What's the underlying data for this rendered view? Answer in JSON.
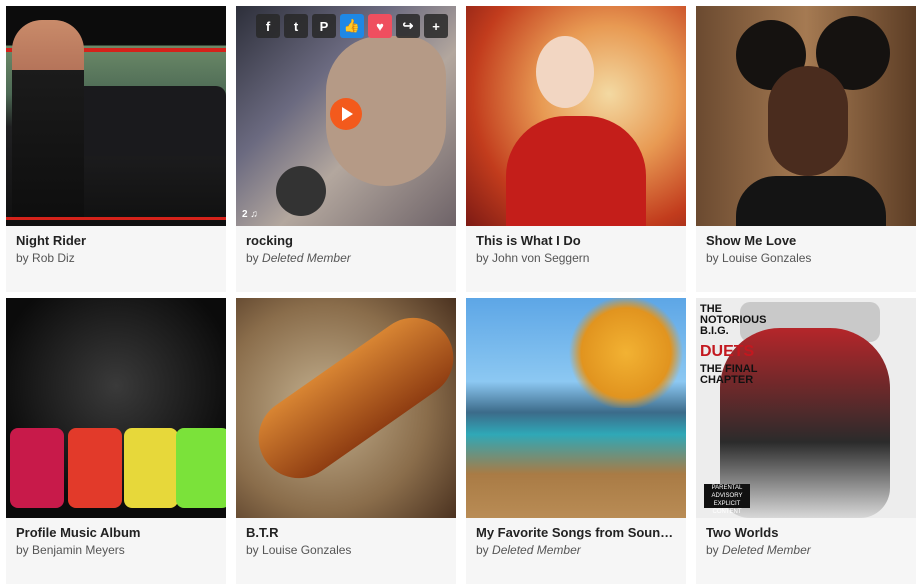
{
  "albums": [
    {
      "title": "Night Rider",
      "by": "by",
      "author": "Rob Diz",
      "author_deleted": false
    },
    {
      "title": "rocking",
      "by": "by",
      "author": "Deleted Member",
      "author_deleted": true,
      "track_count": "2"
    },
    {
      "title": "This is What I Do",
      "by": "by",
      "author": "John von Seggern",
      "author_deleted": false
    },
    {
      "title": "Show Me Love",
      "by": "by",
      "author": "Louise Gonzales",
      "author_deleted": false
    },
    {
      "title": "Profile Music Album",
      "by": "by",
      "author": "Benjamin Meyers",
      "author_deleted": false
    },
    {
      "title": "B.T.R",
      "by": "by",
      "author": "Louise Gonzales",
      "author_deleted": false
    },
    {
      "title": "My Favorite Songs from Soun…",
      "by": "by",
      "author": "Deleted Member",
      "author_deleted": true
    },
    {
      "title": "Two Worlds",
      "by": "by",
      "author": "Deleted Member",
      "author_deleted": true
    }
  ],
  "share": {
    "facebook": "f",
    "twitter": "t",
    "pinterest": "P",
    "like": "👍",
    "love": "♥",
    "forward": "↪",
    "add": "+"
  },
  "cover_text": {
    "notorious": "THE NOTORIOUS B.I.G.",
    "duets": "DUETS",
    "final": "THE FINAL CHAPTER",
    "advisory": "PARENTAL ADVISORY EXPLICIT CONTENT"
  },
  "icons": {
    "share": [
      "facebook-icon",
      "twitter-icon",
      "pinterest-icon",
      "like-icon",
      "heart-icon",
      "share-forward-icon",
      "plus-icon"
    ],
    "play": "play-icon",
    "music": "music-note-icon"
  },
  "colors": {
    "card_bg": "#f6f6f6",
    "play_orange": "#f35a1c",
    "like_blue": "#1e88e5",
    "love_red": "#ef4f5f"
  }
}
